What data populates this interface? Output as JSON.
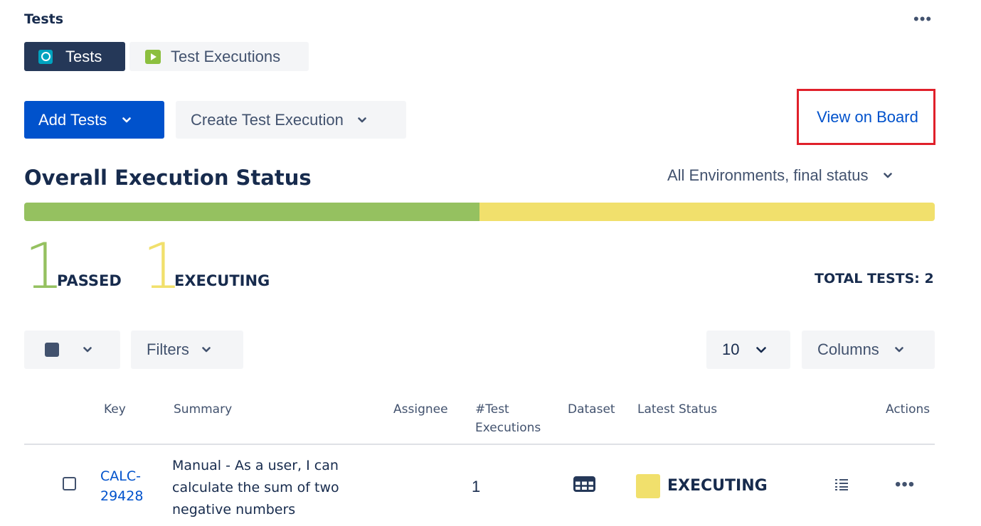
{
  "section_title": "Tests",
  "tabs": [
    {
      "label": "Tests",
      "icon": "tests-icon",
      "active": true
    },
    {
      "label": "Test Executions",
      "icon": "test-executions-icon",
      "active": false
    }
  ],
  "toolbar": {
    "add_tests_label": "Add Tests",
    "create_execution_label": "Create Test Execution",
    "view_board_label": "View on Board"
  },
  "overall": {
    "title": "Overall Execution Status",
    "environment_filter": "All Environments, final status",
    "passed_count": "1",
    "passed_label": "PASSED",
    "executing_count": "1",
    "executing_label": "EXECUTING",
    "total_label": "TOTAL TESTS: 2",
    "passed_fraction": 0.5,
    "executing_fraction": 0.5,
    "colors": {
      "passed": "#95c160",
      "executing": "#f1e06c",
      "primary": "#0052cc",
      "highlight": "#e0202a"
    }
  },
  "table_controls": {
    "filters_label": "Filters",
    "page_size": "10",
    "columns_label": "Columns"
  },
  "table": {
    "headers": {
      "key": "Key",
      "summary": "Summary",
      "assignee": "Assignee",
      "test_executions_1": "#Test",
      "test_executions_2": "Executions",
      "dataset": "Dataset",
      "latest_status": "Latest Status",
      "actions": "Actions"
    },
    "rows": [
      {
        "key_1": "CALC-",
        "key_2": "29428",
        "summary_1": "Manual - As a user, I can",
        "summary_2": "calculate the sum of two",
        "summary_3": "negative numbers",
        "assignee": "",
        "test_executions": "1",
        "dataset_icon": "table-grid-icon",
        "latest_status": "EXECUTING"
      }
    ]
  }
}
